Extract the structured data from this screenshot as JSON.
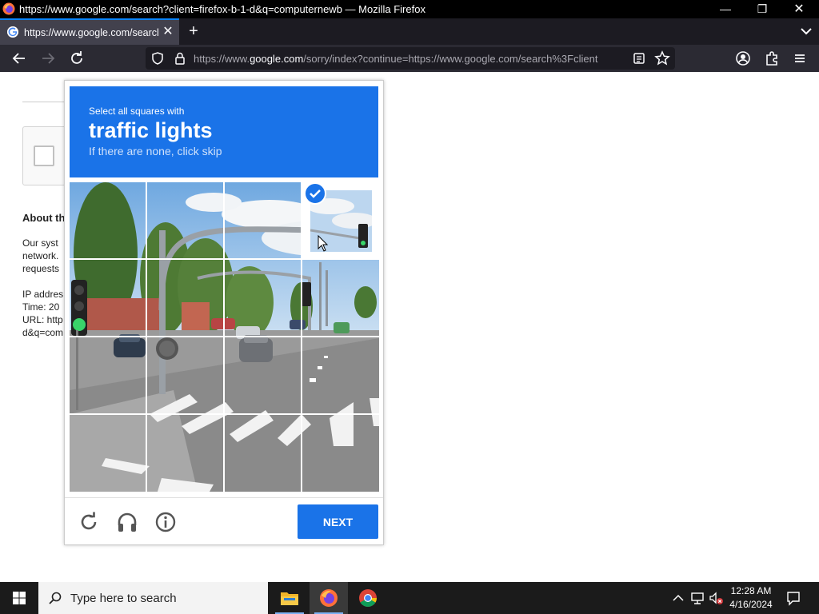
{
  "window": {
    "title": "https://www.google.com/search?client=firefox-b-1-d&q=computernewb — Mozilla Firefox"
  },
  "tab": {
    "label": "https://www.google.com/search?client=firefox-b-1-d&q=computernewb",
    "close": "✕",
    "new_tab": "+"
  },
  "address_bar": {
    "url_prefix": "https://www.",
    "url_host": "google.com",
    "url_rest": "/sorry/index?continue=https://www.google.com/search%3Fclient"
  },
  "page": {
    "heading": "About th",
    "p1": "Our syst",
    "p2": "network.",
    "p3": "requests",
    "ip": "IP addres",
    "time": "Time: 20",
    "url": "URL: http",
    "url2": "d&q=com"
  },
  "captcha": {
    "instruction": "Select all squares with",
    "target": "traffic lights",
    "hint": "If there are none, click skip",
    "next_label": "NEXT",
    "selected_tiles": [
      3
    ]
  },
  "taskbar": {
    "search_placeholder": "Type here to search",
    "time": "12:28 AM",
    "date": "4/16/2024"
  },
  "colors": {
    "accent": "#1a73e8",
    "titlebar": "#000000",
    "toolbar": "#2b2a33",
    "taskbar": "#1b1b1b"
  }
}
